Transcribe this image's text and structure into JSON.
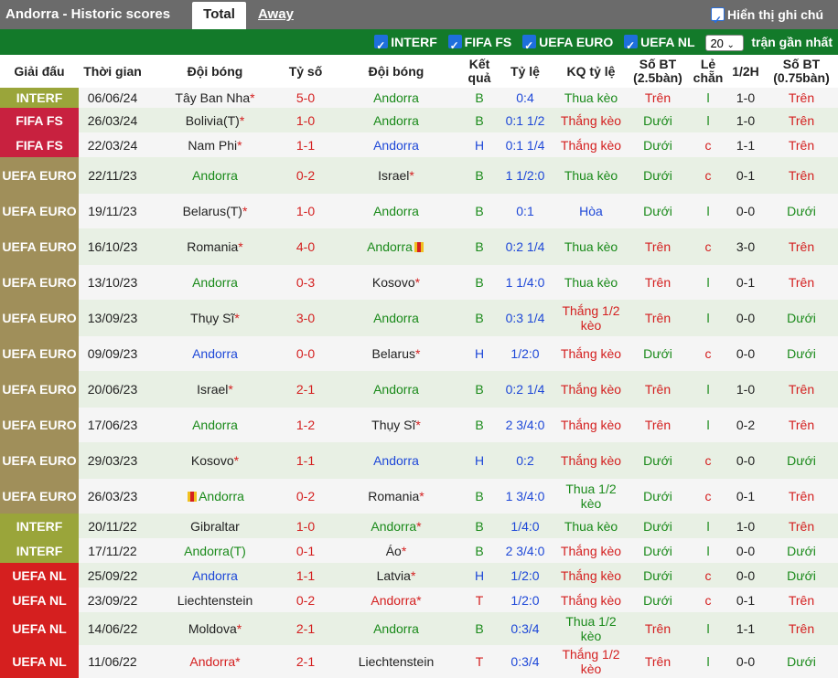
{
  "header": {
    "title": "Andorra - Historic scores",
    "tabs": [
      "Total",
      "Away"
    ],
    "note_label": "Hiển thị ghi chú"
  },
  "filters": {
    "items": [
      "INTERF",
      "FIFA FS",
      "UEFA EURO",
      "UEFA NL"
    ],
    "count_value": "20",
    "count_suffix": "trận gần nhất"
  },
  "columns": [
    "Giải đấu",
    "Thời gian",
    "Đội bóng",
    "Tỷ số",
    "Đội bóng",
    "Kết quả",
    "Tỷ lệ",
    "KQ tỷ lệ",
    "Số BT (2.5bàn)",
    "Lẻ chẵn",
    "1/2H",
    "Số BT (0.75bàn)"
  ],
  "colors": {
    "INTERF": "#9aa53a",
    "FIFA FS": "#c8213f",
    "UEFA EURO": "#a08f5a",
    "UEFA NL": "#d51f1f",
    "green": "#1a8a1a",
    "blue": "#1e48d8",
    "red": "#d42020"
  },
  "rows": [
    {
      "league": "INTERF",
      "date": "06/06/24",
      "home": "Tây Ban Nha",
      "home_star": true,
      "home_color": "dark",
      "score": "5-0",
      "away": "Andorra",
      "away_star": false,
      "away_color": "green",
      "result": "B",
      "handicap": "0:4",
      "hres": "Thua kèo",
      "ou": "Trên",
      "oe": "l",
      "ht": "1-0",
      "ou2": "Trên"
    },
    {
      "league": "FIFA FS",
      "date": "26/03/24",
      "home": "Bolivia(T)",
      "home_star": true,
      "home_color": "dark",
      "score": "1-0",
      "away": "Andorra",
      "away_star": false,
      "away_color": "green",
      "result": "B",
      "handicap": "0:1 1/2",
      "hres": "Thắng kèo",
      "ou": "Dưới",
      "oe": "l",
      "ht": "1-0",
      "ou2": "Trên"
    },
    {
      "league": "FIFA FS",
      "date": "22/03/24",
      "home": "Nam Phi",
      "home_star": true,
      "home_color": "dark",
      "score": "1-1",
      "away": "Andorra",
      "away_star": false,
      "away_color": "blue",
      "result": "H",
      "handicap": "0:1 1/4",
      "hres": "Thắng kèo",
      "ou": "Dưới",
      "oe": "c",
      "ht": "1-1",
      "ou2": "Trên"
    },
    {
      "league": "UEFA EURO",
      "date": "22/11/23",
      "home": "Andorra",
      "home_star": false,
      "home_color": "green",
      "score": "0-2",
      "away": "Israel",
      "away_star": true,
      "away_color": "dark",
      "result": "B",
      "handicap": "1 1/2:0",
      "hres": "Thua kèo",
      "ou": "Dưới",
      "oe": "c",
      "ht": "0-1",
      "ou2": "Trên"
    },
    {
      "league": "UEFA EURO",
      "date": "19/11/23",
      "home": "Belarus(T)",
      "home_star": true,
      "home_color": "dark",
      "score": "1-0",
      "away": "Andorra",
      "away_star": false,
      "away_color": "green",
      "result": "B",
      "handicap": "0:1",
      "hres": "Hòa",
      "ou": "Dưới",
      "oe": "l",
      "ht": "0-0",
      "ou2": "Dưới"
    },
    {
      "league": "UEFA EURO",
      "date": "16/10/23",
      "home": "Romania",
      "home_star": true,
      "home_color": "dark",
      "score": "4-0",
      "away": "Andorra",
      "away_star": false,
      "away_color": "green",
      "away_flag": true,
      "result": "B",
      "handicap": "0:2 1/4",
      "hres": "Thua kèo",
      "ou": "Trên",
      "oe": "c",
      "ht": "3-0",
      "ou2": "Trên"
    },
    {
      "league": "UEFA EURO",
      "date": "13/10/23",
      "home": "Andorra",
      "home_star": false,
      "home_color": "green",
      "score": "0-3",
      "away": "Kosovo",
      "away_star": true,
      "away_color": "dark",
      "result": "B",
      "handicap": "1 1/4:0",
      "hres": "Thua kèo",
      "ou": "Trên",
      "oe": "l",
      "ht": "0-1",
      "ou2": "Trên"
    },
    {
      "league": "UEFA EURO",
      "date": "13/09/23",
      "home": "Thụy Sĩ",
      "home_star": true,
      "home_color": "dark",
      "score": "3-0",
      "away": "Andorra",
      "away_star": false,
      "away_color": "green",
      "result": "B",
      "handicap": "0:3 1/4",
      "hres": "Thắng 1/2 kèo",
      "ou": "Trên",
      "oe": "l",
      "ht": "0-0",
      "ou2": "Dưới"
    },
    {
      "league": "UEFA EURO",
      "date": "09/09/23",
      "home": "Andorra",
      "home_star": false,
      "home_color": "blue",
      "score": "0-0",
      "away": "Belarus",
      "away_star": true,
      "away_color": "dark",
      "result": "H",
      "handicap": "1/2:0",
      "hres": "Thắng kèo",
      "ou": "Dưới",
      "oe": "c",
      "ht": "0-0",
      "ou2": "Dưới"
    },
    {
      "league": "UEFA EURO",
      "date": "20/06/23",
      "home": "Israel",
      "home_star": true,
      "home_color": "dark",
      "score": "2-1",
      "away": "Andorra",
      "away_star": false,
      "away_color": "green",
      "result": "B",
      "handicap": "0:2 1/4",
      "hres": "Thắng kèo",
      "ou": "Trên",
      "oe": "l",
      "ht": "1-0",
      "ou2": "Trên"
    },
    {
      "league": "UEFA EURO",
      "date": "17/06/23",
      "home": "Andorra",
      "home_star": false,
      "home_color": "green",
      "score": "1-2",
      "away": "Thụy Sĩ",
      "away_star": true,
      "away_color": "dark",
      "result": "B",
      "handicap": "2 3/4:0",
      "hres": "Thắng kèo",
      "ou": "Trên",
      "oe": "l",
      "ht": "0-2",
      "ou2": "Trên"
    },
    {
      "league": "UEFA EURO",
      "date": "29/03/23",
      "home": "Kosovo",
      "home_star": true,
      "home_color": "dark",
      "score": "1-1",
      "away": "Andorra",
      "away_star": false,
      "away_color": "blue",
      "result": "H",
      "handicap": "0:2",
      "hres": "Thắng kèo",
      "ou": "Dưới",
      "oe": "c",
      "ht": "0-0",
      "ou2": "Dưới"
    },
    {
      "league": "UEFA EURO",
      "date": "26/03/23",
      "home": "Andorra",
      "home_star": false,
      "home_color": "green",
      "home_flag": true,
      "score": "0-2",
      "away": "Romania",
      "away_star": true,
      "away_color": "dark",
      "result": "B",
      "handicap": "1 3/4:0",
      "hres": "Thua 1/2 kèo",
      "ou": "Dưới",
      "oe": "c",
      "ht": "0-1",
      "ou2": "Trên"
    },
    {
      "league": "INTERF",
      "date": "20/11/22",
      "home": "Gibraltar",
      "home_star": false,
      "home_color": "dark",
      "score": "1-0",
      "away": "Andorra",
      "away_star": true,
      "away_color": "green",
      "result": "B",
      "handicap": "1/4:0",
      "hres": "Thua kèo",
      "ou": "Dưới",
      "oe": "l",
      "ht": "1-0",
      "ou2": "Trên"
    },
    {
      "league": "INTERF",
      "date": "17/11/22",
      "home": "Andorra(T)",
      "home_star": false,
      "home_color": "green",
      "score": "0-1",
      "away": "Áo",
      "away_star": true,
      "away_color": "dark",
      "result": "B",
      "handicap": "2 3/4:0",
      "hres": "Thắng kèo",
      "ou": "Dưới",
      "oe": "l",
      "ht": "0-0",
      "ou2": "Dưới"
    },
    {
      "league": "UEFA NL",
      "date": "25/09/22",
      "home": "Andorra",
      "home_star": false,
      "home_color": "blue",
      "score": "1-1",
      "away": "Latvia",
      "away_star": true,
      "away_color": "dark",
      "result": "H",
      "handicap": "1/2:0",
      "hres": "Thắng kèo",
      "ou": "Dưới",
      "oe": "c",
      "ht": "0-0",
      "ou2": "Dưới"
    },
    {
      "league": "UEFA NL",
      "date": "23/09/22",
      "home": "Liechtenstein",
      "home_star": false,
      "home_color": "dark",
      "score": "0-2",
      "away": "Andorra",
      "away_star": true,
      "away_color": "red",
      "result": "T",
      "handicap": "1/2:0",
      "hres": "Thắng kèo",
      "ou": "Dưới",
      "oe": "c",
      "ht": "0-1",
      "ou2": "Trên"
    },
    {
      "league": "UEFA NL",
      "date": "14/06/22",
      "home": "Moldova",
      "home_star": true,
      "home_color": "dark",
      "score": "2-1",
      "away": "Andorra",
      "away_star": false,
      "away_color": "green",
      "result": "B",
      "handicap": "0:3/4",
      "hres": "Thua 1/2 kèo",
      "ou": "Trên",
      "oe": "l",
      "ht": "1-1",
      "ou2": "Trên"
    },
    {
      "league": "UEFA NL",
      "date": "11/06/22",
      "home": "Andorra",
      "home_star": true,
      "home_color": "red",
      "score": "2-1",
      "away": "Liechtenstein",
      "away_star": false,
      "away_color": "dark",
      "result": "T",
      "handicap": "0:3/4",
      "hres": "Thắng 1/2 kèo",
      "ou": "Trên",
      "oe": "l",
      "ht": "0-0",
      "ou2": "Dưới"
    }
  ]
}
